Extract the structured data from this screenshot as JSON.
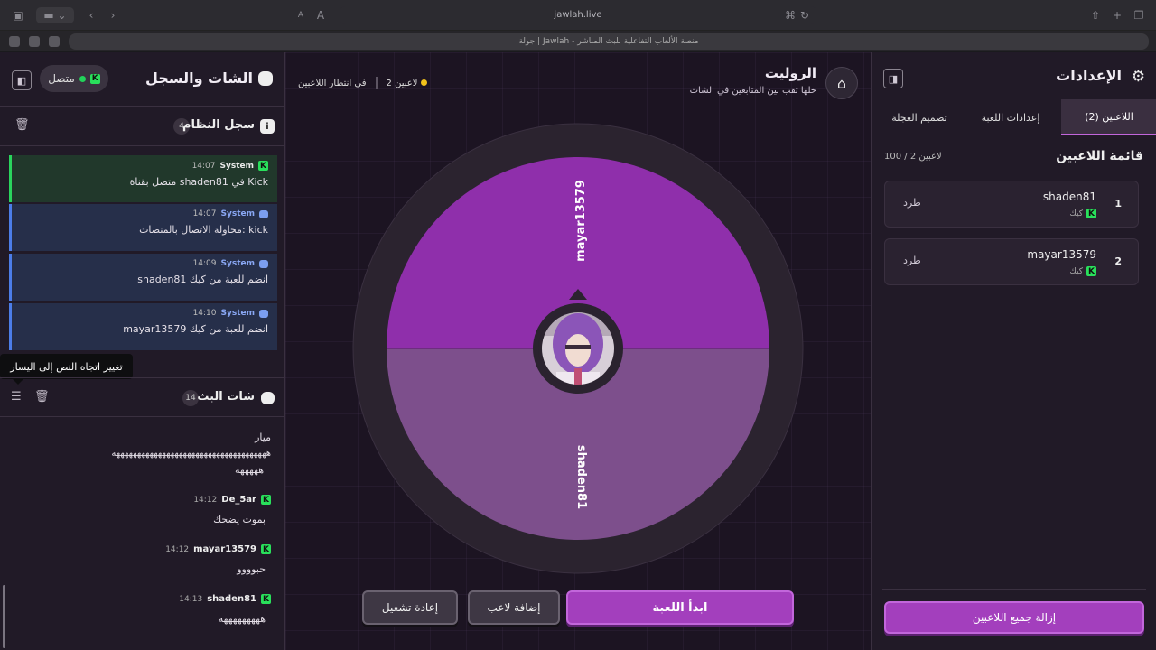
{
  "browser": {
    "url": "jawlah.live",
    "tab_title": "جولة | Jawlah - منصة الألعاب التفاعلية للبث المباشر"
  },
  "chat_panel": {
    "title": "الشات والسجل",
    "status_label": "متصل",
    "system_log": {
      "title": "سجل النظام",
      "count": "4",
      "messages": [
        {
          "sender": "System",
          "time": "14:07",
          "text": "متصل بقناة shaden81 في Kick",
          "kind": "kick"
        },
        {
          "sender": "System",
          "time": "14:07",
          "text": "محاولة الاتصال بالمنصات: kick",
          "kind": "info"
        },
        {
          "sender": "System",
          "time": "14:09",
          "text": "shaden81 انضم للعبة من كيك",
          "kind": "info"
        },
        {
          "sender": "System",
          "time": "14:10",
          "text": "mayar13579 انضم للعبة من كيك",
          "kind": "info"
        }
      ]
    },
    "tooltip": "تغيير اتجاه النص إلى اليسار",
    "stream_chat": {
      "title": "شات البث",
      "count": "14",
      "partial_top": {
        "line1": "ميار",
        "line2": "هههههههههههههههههههههههههههههههههههههه",
        "line3": "هههههه"
      },
      "messages": [
        {
          "sender": "De_5ar",
          "time": "14:12",
          "text": "بموت يضحك"
        },
        {
          "sender": "mayar13579",
          "time": "14:12",
          "text": "حبوووو"
        },
        {
          "sender": "shaden81",
          "time": "14:13",
          "text": "هههههههههه"
        }
      ]
    }
  },
  "game": {
    "title": "الروليت",
    "subtitle": "خلها تقب بين المتابعين في الشات",
    "player_count": "2 لاعبين",
    "waiting": "في انتظار اللاعبين",
    "wheel": {
      "segments": [
        {
          "name": "mayar13579",
          "color": "#8f2fab"
        },
        {
          "name": "shaden81",
          "color": "#7d4f8c"
        }
      ]
    },
    "buttons": {
      "start": "ابدأ اللعبة",
      "add_player": "إضافة لاعب",
      "restart": "إعادة تشغيل"
    }
  },
  "settings": {
    "title": "الإعدادات",
    "tabs": [
      "اللاعبين (2)",
      "إعدادات اللعبة",
      "تصميم العجلة"
    ],
    "players_heading": "قائمة اللاعبين",
    "players_count": "100 / 2 لاعبين",
    "players": [
      {
        "num": "1",
        "name": "shaden81",
        "platform": "كيك",
        "kick_label": "طرد"
      },
      {
        "num": "2",
        "name": "mayar13579",
        "platform": "كيك",
        "kick_label": "طرد"
      }
    ],
    "remove_all": "إزالة جميع اللاعبين"
  },
  "colors": {
    "accent": "#a33fbd",
    "kick_green": "#29e05b",
    "wheel_ring": "#2b232f"
  }
}
